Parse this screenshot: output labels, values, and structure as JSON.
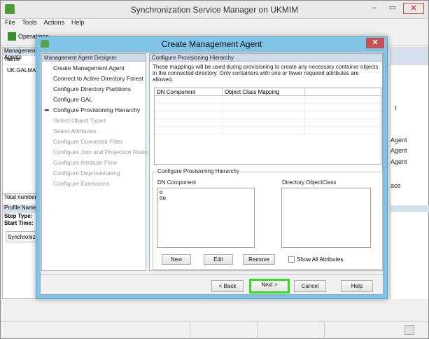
{
  "app": {
    "title": "Synchronization Service Manager on UKMIM",
    "menu": [
      "File",
      "Tools",
      "Actions",
      "Help"
    ],
    "toolbar_first_label": "Operations",
    "left_pane": {
      "header": "Management Agents",
      "column": "Name",
      "row": "UK.GALMA",
      "total_label": "Total number",
      "profile_label": "Profile Name",
      "step_type": "Step Type:",
      "start_time": "Start Time:",
      "sync_tab": "Synchronization"
    },
    "right_pane_fragments": [
      "t",
      "Agent",
      "Agent",
      "Agent",
      "ace"
    ]
  },
  "dialog": {
    "title": "Create Management Agent",
    "close_glyph": "✕",
    "designer_header": "Management Agent Designer",
    "steps": [
      {
        "label": "Create Management Agent",
        "state": "done"
      },
      {
        "label": "Connect to Active Directory Forest",
        "state": "done"
      },
      {
        "label": "Configure Directory Partitions",
        "state": "done"
      },
      {
        "label": "Configure GAL",
        "state": "done"
      },
      {
        "label": "Configure Provisioning Hierarchy",
        "state": "current"
      },
      {
        "label": "Select Object Types",
        "state": "disabled"
      },
      {
        "label": "Select Attributes",
        "state": "disabled"
      },
      {
        "label": "Configure Connector Filter",
        "state": "disabled"
      },
      {
        "label": "Configure Join and Projection Rules",
        "state": "disabled"
      },
      {
        "label": "Configure Attribute Flow",
        "state": "disabled"
      },
      {
        "label": "Configure Deprovisioning",
        "state": "disabled"
      },
      {
        "label": "Configure Extensions",
        "state": "disabled"
      }
    ],
    "content_header": "Configure Provisioning Hierarchy",
    "description": "These mappings will be used during provisioning to create any necessary container objects in the connected directory.  Only containers with one or fewer required attributes are allowed.",
    "mapping_grid": {
      "columns": [
        "DN Component",
        "Object Class Mapping"
      ]
    },
    "group": {
      "title": "Configure Provisioning Hierarchy",
      "dn_label": "DN Component",
      "dn_items": [
        "o",
        "ou"
      ],
      "objclass_label": "Directory ObjectClass",
      "buttons": {
        "new": "New",
        "edit": "Edit",
        "remove": "Remove"
      },
      "show_all_label": "Show All Attributes"
    },
    "footer_buttons": {
      "back": "< Back",
      "next": "Next >",
      "cancel": "Cancel",
      "help": "Help"
    }
  },
  "colors": {
    "dialog_frame": "#7fc3e6",
    "highlight": "#33dd22",
    "close": "#c75050"
  }
}
